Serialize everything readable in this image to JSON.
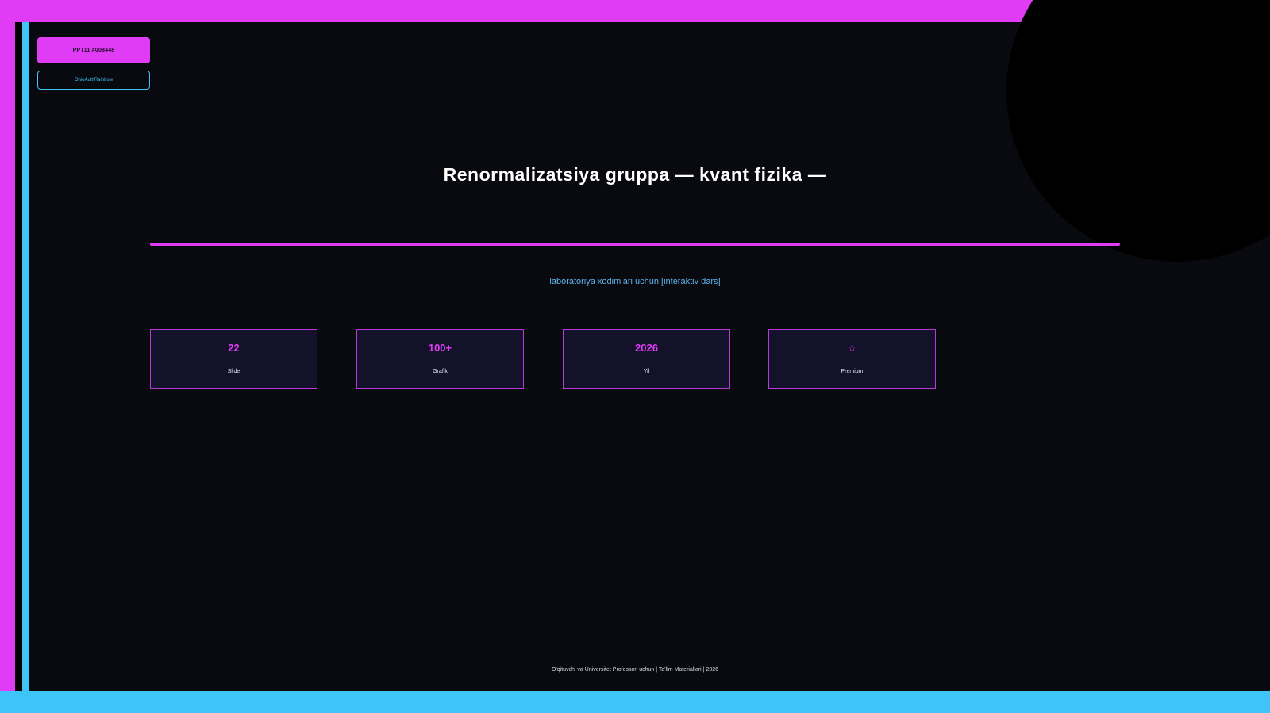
{
  "badges": {
    "code": "PPT11 #008448",
    "theme": "OhioAuthRainbow"
  },
  "title": "Renormalizatsiya gruppa — kvant fizika —",
  "subtitle": "laboratoriya xodimlari uchun [interaktiv dars]",
  "stats": [
    {
      "value": "22",
      "label": "Slide"
    },
    {
      "value": "100+",
      "label": "Grafik"
    },
    {
      "value": "2026",
      "label": "Yil"
    },
    {
      "value": "☆",
      "label": "Premium"
    }
  ],
  "footer": "O'qituvchi va Universitet Professori uchun | Ta'lim Materiallari | 2026",
  "colors": {
    "background": "#090a10",
    "magenta": "#e03cf6",
    "cyan": "#3ec4f7",
    "card_fill": "#14122a"
  }
}
